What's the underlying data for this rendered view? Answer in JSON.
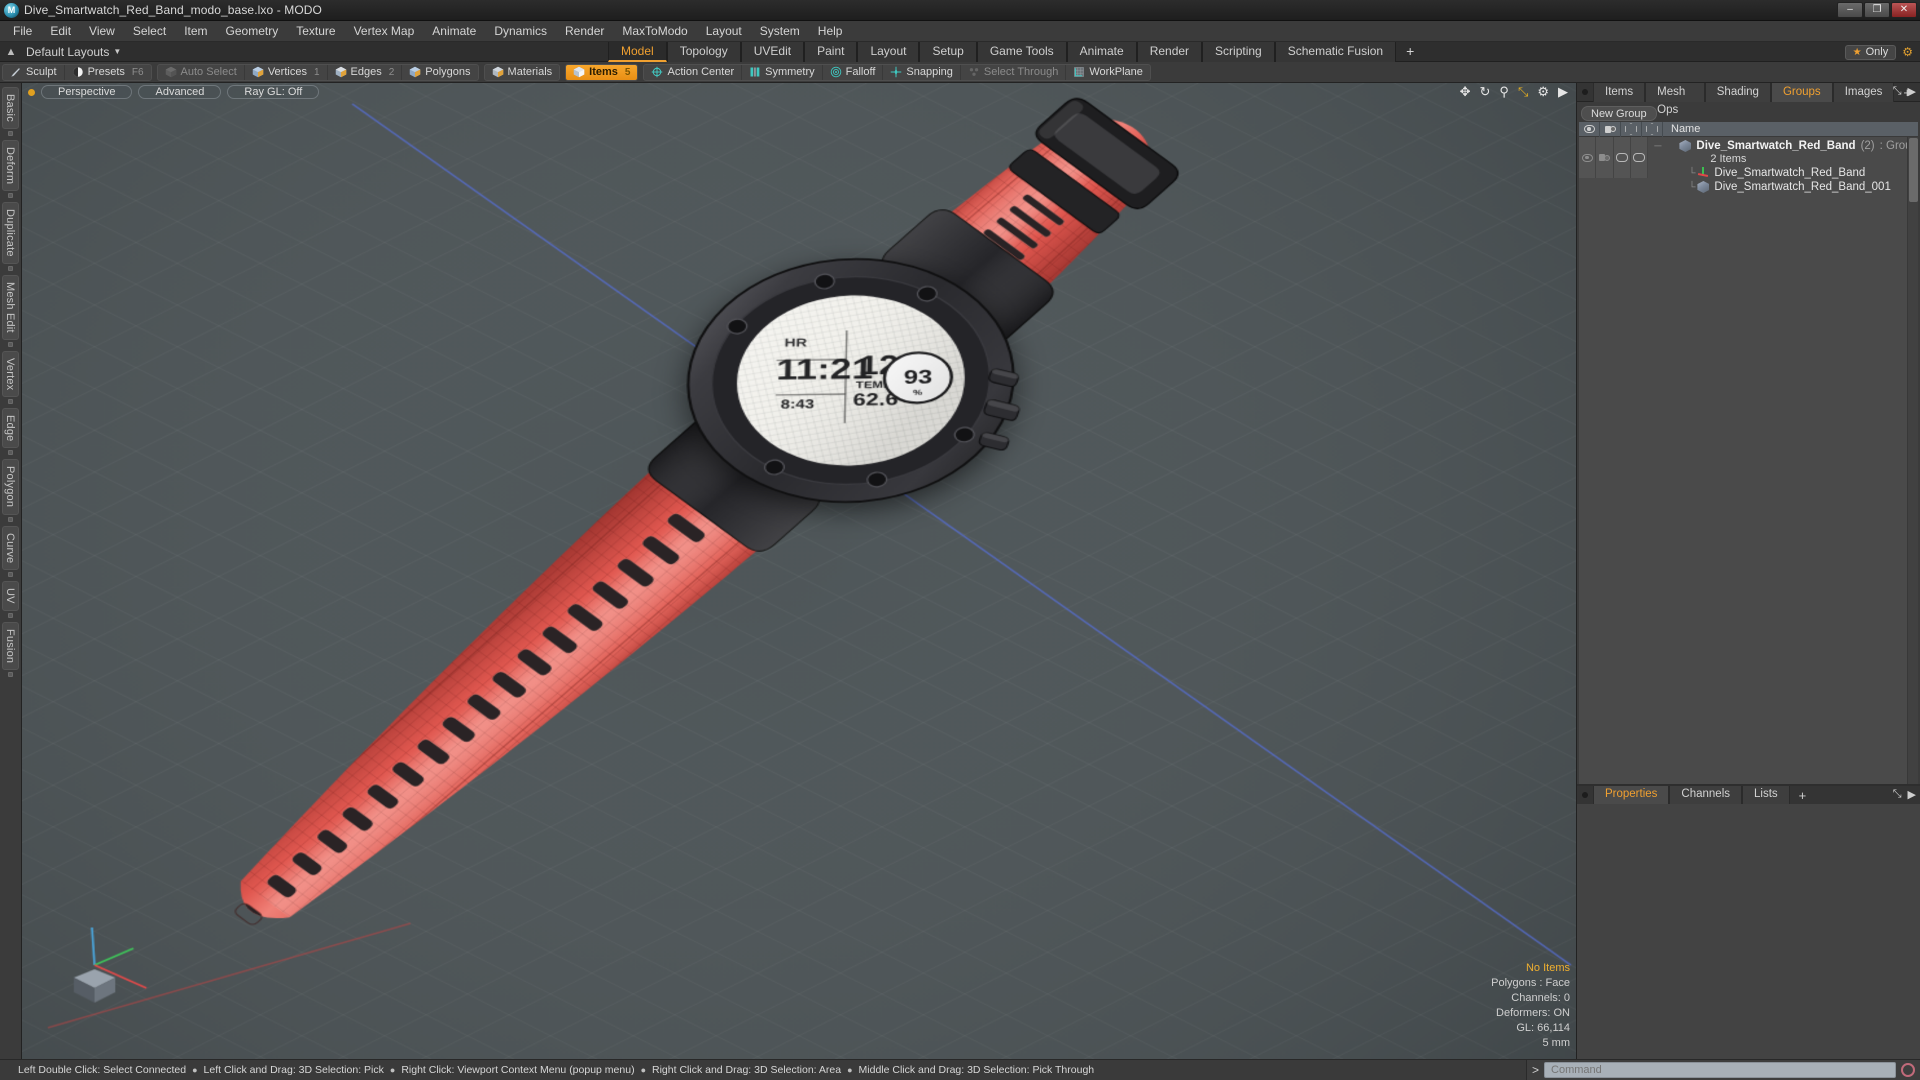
{
  "titlebar": {
    "logo_icon": "modo-logo-icon",
    "title": "Dive_Smartwatch_Red_Band_modo_base.lxo - MODO",
    "minimize": "–",
    "maximize": "❐",
    "close": "✕"
  },
  "menubar": {
    "items": [
      {
        "label": "File"
      },
      {
        "label": "Edit"
      },
      {
        "label": "View"
      },
      {
        "label": "Select"
      },
      {
        "label": "Item"
      },
      {
        "label": "Geometry"
      },
      {
        "label": "Texture"
      },
      {
        "label": "Vertex Map"
      },
      {
        "label": "Animate"
      },
      {
        "label": "Dynamics"
      },
      {
        "label": "Render"
      },
      {
        "label": "MaxToModo"
      },
      {
        "label": "Layout"
      },
      {
        "label": "System"
      },
      {
        "label": "Help"
      }
    ]
  },
  "layoutbar": {
    "home_icon": "home-arrow-icon",
    "layout_label": "Default Layouts",
    "caret_icon": "chevron-down-icon",
    "tabs": [
      {
        "label": "Model",
        "active": true
      },
      {
        "label": "Topology",
        "active": false
      },
      {
        "label": "UVEdit",
        "active": false
      },
      {
        "label": "Paint",
        "active": false
      },
      {
        "label": "Layout",
        "active": false
      },
      {
        "label": "Setup",
        "active": false
      },
      {
        "label": "Game Tools",
        "active": false
      },
      {
        "label": "Animate",
        "active": false
      },
      {
        "label": "Render",
        "active": false
      },
      {
        "label": "Scripting",
        "active": false
      },
      {
        "label": "Schematic Fusion",
        "active": false
      }
    ],
    "add_tab_label": "+",
    "only_label": "Only",
    "only_star_icon": "star-icon",
    "gear_icon": "gear-icon"
  },
  "modebar": {
    "groups": [
      {
        "buttons": [
          {
            "label": "Sculpt",
            "icon": "sculpt-brush-icon",
            "state": "normal",
            "num": ""
          },
          {
            "label": "Presets",
            "icon": "presets-sphere-icon",
            "state": "normal",
            "num": "F6"
          }
        ]
      },
      {
        "buttons": [
          {
            "label": "Auto Select",
            "icon": "auto-select-cube-icon",
            "state": "disabled",
            "num": ""
          },
          {
            "label": "Vertices",
            "icon": "vertices-cube-icon",
            "state": "normal",
            "num": "1"
          },
          {
            "label": "Edges",
            "icon": "edges-cube-icon",
            "state": "normal",
            "num": "2"
          },
          {
            "label": "Polygons",
            "icon": "polygons-cube-icon",
            "state": "normal",
            "num": ""
          }
        ]
      },
      {
        "buttons": [
          {
            "label": "Materials",
            "icon": "materials-cube-icon",
            "state": "normal",
            "num": ""
          }
        ]
      },
      {
        "buttons": [
          {
            "label": "Items",
            "icon": "items-cube-icon",
            "state": "active",
            "num": "5"
          }
        ]
      },
      {
        "buttons": [
          {
            "label": "Action Center",
            "icon": "action-center-icon",
            "state": "normal",
            "num": ""
          },
          {
            "label": "Symmetry",
            "icon": "symmetry-icon",
            "state": "normal",
            "num": ""
          },
          {
            "label": "Falloff",
            "icon": "falloff-icon",
            "state": "normal",
            "num": ""
          },
          {
            "label": "Snapping",
            "icon": "snapping-icon",
            "state": "normal",
            "num": ""
          },
          {
            "label": "Select Through",
            "icon": "select-through-icon",
            "state": "disabled",
            "num": ""
          },
          {
            "label": "WorkPlane",
            "icon": "workplane-grid-icon",
            "state": "normal",
            "num": ""
          }
        ]
      }
    ]
  },
  "left_tool_tabs": {
    "items": [
      {
        "label": "Basic"
      },
      {
        "label": "Deform"
      },
      {
        "label": "Duplicate"
      },
      {
        "label": "Mesh Edit"
      },
      {
        "label": "Vertex"
      },
      {
        "label": "Edge"
      },
      {
        "label": "Polygon"
      },
      {
        "label": "Curve"
      },
      {
        "label": "UV"
      },
      {
        "label": "Fusion"
      }
    ]
  },
  "viewport": {
    "indicator_icon": "viewport-active-dot-icon",
    "buttons": [
      {
        "label": "Perspective",
        "name": "viewport-projection-button"
      },
      {
        "label": "Advanced",
        "name": "viewport-shading-button"
      },
      {
        "label": "Ray GL: Off",
        "name": "viewport-raygl-button"
      }
    ],
    "corner_icons": [
      {
        "icon": "move-icon",
        "glyph": "✥"
      },
      {
        "icon": "rotate-icon",
        "glyph": "↻"
      },
      {
        "icon": "zoom-search-icon",
        "glyph": "⚲"
      },
      {
        "icon": "fit-expand-icon",
        "glyph": "⤡"
      },
      {
        "icon": "gear-icon",
        "glyph": "⚙"
      },
      {
        "icon": "play-arrow-icon",
        "glyph": "▶"
      }
    ],
    "stats": {
      "selection": "No Items",
      "polygons": "Polygons : Face",
      "channels": "Channels: 0",
      "deformers": "Deformers: ON",
      "gl": "GL: 66,114",
      "grid": "5 mm"
    },
    "model": {
      "description": "Red-banded dive smartwatch 3D model with wireframe",
      "band_color": "#e0574f",
      "case_color": "#2b2b2d",
      "background_color": "#474f52",
      "watchface": {
        "time": "11:21",
        "seconds": "8:43",
        "big_number": "12",
        "gauge_value": "93",
        "temp_label": "TEMP",
        "temp_value": "62.6"
      }
    }
  },
  "right_panel": {
    "tabs": [
      {
        "label": "Items",
        "active": false
      },
      {
        "label": "Mesh Ops",
        "active": false
      },
      {
        "label": "Shading",
        "active": false
      },
      {
        "label": "Groups",
        "active": true
      },
      {
        "label": "Images",
        "active": false
      }
    ],
    "add_tab_label": "+",
    "corner_icons": [
      {
        "icon": "maximize-panel-icon",
        "glyph": "⤡"
      },
      {
        "icon": "panel-menu-arrow-icon",
        "glyph": "▶"
      }
    ],
    "new_group_label": "New Group",
    "columns": [
      {
        "icon": "visibility-eye-icon"
      },
      {
        "icon": "render-camera-icon"
      },
      {
        "icon": "wireframe-pill-icon"
      },
      {
        "icon": "shaded-hex-icon"
      },
      {
        "label": "Name"
      }
    ],
    "rows": [
      {
        "name": "Dive_Smartwatch_Red_Band",
        "count": "(2)",
        "type": ": Group",
        "subtitle": "2 Items",
        "icon": "group-cube-icon",
        "bold": true
      },
      {
        "name": "Dive_Smartwatch_Red_Band",
        "icon": "locator-axis-icon",
        "bold": false
      },
      {
        "name": "Dive_Smartwatch_Red_Band_001",
        "icon": "mesh-cube-icon",
        "bold": false
      }
    ]
  },
  "properties_panel": {
    "tabs": [
      {
        "label": "Properties",
        "active": true
      },
      {
        "label": "Channels",
        "active": false
      },
      {
        "label": "Lists",
        "active": false
      }
    ],
    "add_tab_label": "+",
    "corner_icons": [
      {
        "icon": "maximize-panel-icon",
        "glyph": "⤡"
      },
      {
        "icon": "panel-menu-arrow-icon",
        "glyph": "▶"
      }
    ]
  },
  "statusbar": {
    "hints": [
      "Left Double Click: Select Connected",
      "Left Click and Drag: 3D Selection: Pick",
      "Right Click: Viewport Context Menu (popup menu)",
      "Right Click and Drag: 3D Selection: Area",
      "Middle Click and Drag: 3D Selection: Pick Through"
    ],
    "separator_glyph": "●"
  },
  "command_bar": {
    "prompt": ">",
    "placeholder": "Command",
    "value": "",
    "record_icon": "record-circle-icon"
  },
  "colors": {
    "accent": "#f0a030",
    "panel_bg": "#3b3b3b",
    "viewport_bg": "#474f52",
    "band_red": "#e0574f",
    "header_blue": "#5a6066"
  }
}
